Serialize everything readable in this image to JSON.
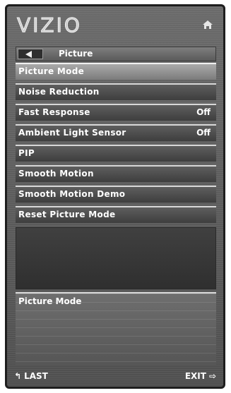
{
  "header": {
    "logo": "VIZIO",
    "home_icon": "home-icon"
  },
  "breadcrumb": {
    "back_icon": "back-arrow-icon",
    "title": "Picture"
  },
  "menu": {
    "items": [
      {
        "label": "Picture Mode",
        "value": "",
        "selected": true
      },
      {
        "label": "Noise Reduction",
        "value": ""
      },
      {
        "label": "Fast Response",
        "value": "Off"
      },
      {
        "label": "Ambient Light Sensor",
        "value": "Off"
      },
      {
        "label": "PIP",
        "value": ""
      },
      {
        "label": "Smooth Motion",
        "value": ""
      },
      {
        "label": "Smooth Motion Demo",
        "value": ""
      },
      {
        "label": "Reset Picture Mode",
        "value": ""
      }
    ]
  },
  "help": {
    "title": "Picture Mode"
  },
  "footer": {
    "last_label": "LAST",
    "last_icon": "return-arrow-icon",
    "exit_label": "EXIT",
    "exit_icon": "exit-arrow-icon"
  },
  "colors": {
    "panel": "#5a5a5a",
    "selected": "#9a9a9a",
    "text": "#ffffff"
  }
}
